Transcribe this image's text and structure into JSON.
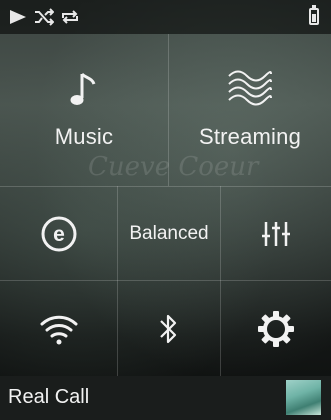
{
  "status_icons": [
    "play-icon",
    "shuffle-icon",
    "repeat-icon",
    "battery-icon"
  ],
  "tiles": {
    "music": {
      "label": "Music",
      "icon": "music-note-icon"
    },
    "streaming": {
      "label": "Streaming",
      "icon": "waves-icon"
    },
    "equalizer_mode": {
      "icon": "e-circle-icon"
    },
    "balanced": {
      "label": "Balanced"
    },
    "equalizer": {
      "icon": "equalizer-sliders-icon"
    },
    "wifi": {
      "icon": "wifi-icon"
    },
    "bluetooth": {
      "icon": "bluetooth-icon"
    },
    "settings": {
      "icon": "gear-icon"
    }
  },
  "watermark": {
    "text": "Cueve Coeur"
  },
  "now_playing": {
    "title": "Real Call"
  },
  "colors": {
    "background": "#0b0d0c",
    "text": "#f2f2f2"
  }
}
